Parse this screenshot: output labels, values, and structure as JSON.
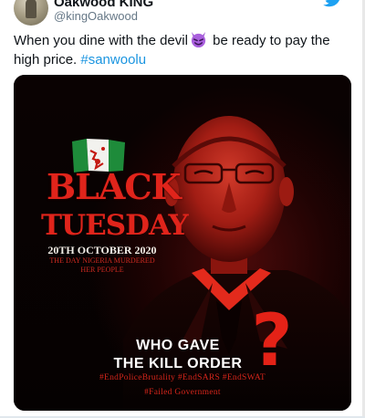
{
  "tweet": {
    "display_name": "Oakwood KING",
    "handle": "@kingOakwood",
    "text_part1": "When you dine with the devil",
    "emoji": "smiling-devil-emoji",
    "text_part2": " be ready to pay the high price. ",
    "hashtag": "#sanwoolu"
  },
  "image": {
    "headline_line1": "BLACK",
    "headline_line2": "TUESDAY",
    "date": "20TH OCTOBER 2020",
    "subtitle_line1": "THE DAY NIGERIA MURDERED",
    "subtitle_line2": "HER PEOPLE",
    "question_line1": "WHO GAVE",
    "question_line2": "THE KILL ORDER",
    "question_mark": "?",
    "hashtags": "#EndPoliceBrutality #EndSARS #EndSWAT",
    "hashtag_failed": "#Failed Government"
  },
  "colors": {
    "link": "#1b95e0",
    "headline_red": "#e0241b",
    "twitter_blue": "#1da1f2"
  },
  "icons": [
    "twitter-bird-icon",
    "smiling-devil-emoji",
    "nigerian-flag-icon"
  ]
}
